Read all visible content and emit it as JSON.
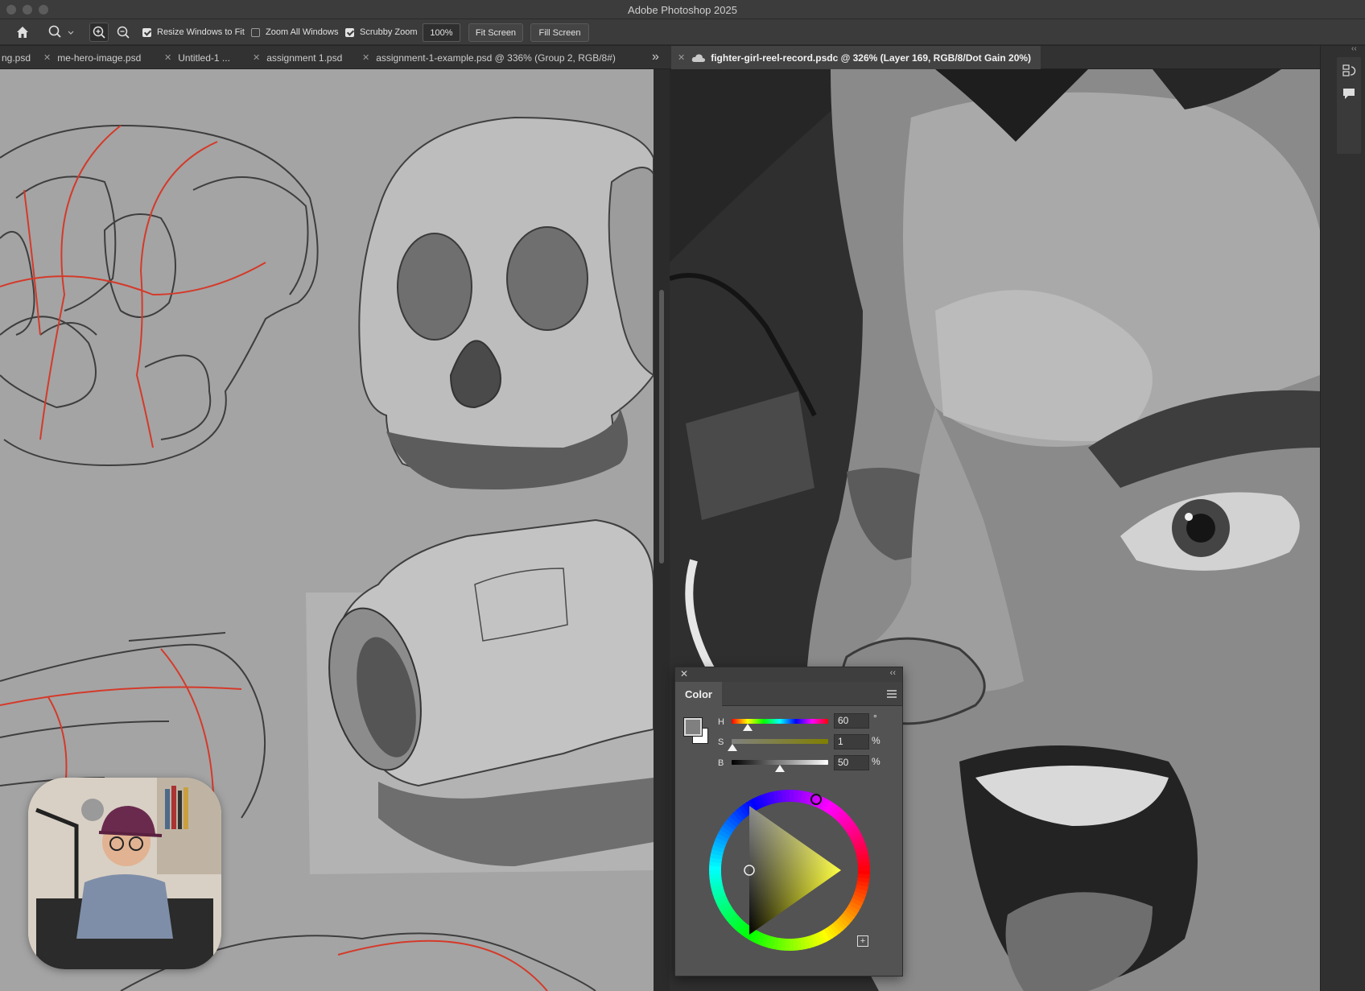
{
  "app": {
    "title": "Adobe Photoshop 2025"
  },
  "options_bar": {
    "zoom_percent": "100%",
    "resize_windows_label": "Resize Windows to Fit",
    "resize_windows_checked": true,
    "zoom_all_label": "Zoom All Windows",
    "zoom_all_checked": false,
    "scrubby_zoom_label": "Scrubby Zoom",
    "scrubby_zoom_checked": true,
    "fit_screen_label": "Fit Screen",
    "fill_screen_label": "Fill Screen"
  },
  "left_tabs": [
    {
      "label": "ng.psd"
    },
    {
      "label": "me-hero-image.psd"
    },
    {
      "label": "Untitled-1 ..."
    },
    {
      "label": "assignment 1.psd"
    },
    {
      "label": "assignment-1-example.psd @ 336% (Group 2, RGB/8#)"
    }
  ],
  "overflow_label": "»",
  "right_tab": {
    "label": "fighter-girl-reel-record.psdc @ 326% (Layer 169, RGB/8/Dot Gain 20%)"
  },
  "color_panel": {
    "tab_label": "Color",
    "h": {
      "label": "H",
      "value": "60",
      "unit": "°",
      "level": 0.17
    },
    "s": {
      "label": "S",
      "value": "1",
      "unit": "%",
      "level": 0.01
    },
    "b": {
      "label": "B",
      "value": "50",
      "unit": "%",
      "level": 0.5
    },
    "foreground_color": "#808080",
    "background_color": "#ffffff"
  },
  "icons": {
    "home": "home-icon",
    "zoom_tool": "zoom-tool-icon",
    "zoom_in": "zoom-in-icon",
    "zoom_out": "zoom-out-icon",
    "close": "close-icon",
    "cloud": "cloud-document-icon",
    "collapse": "collapse-arrows-icon",
    "panel_menu": "panel-menu-icon",
    "history": "history-icon",
    "comments": "comments-icon"
  }
}
